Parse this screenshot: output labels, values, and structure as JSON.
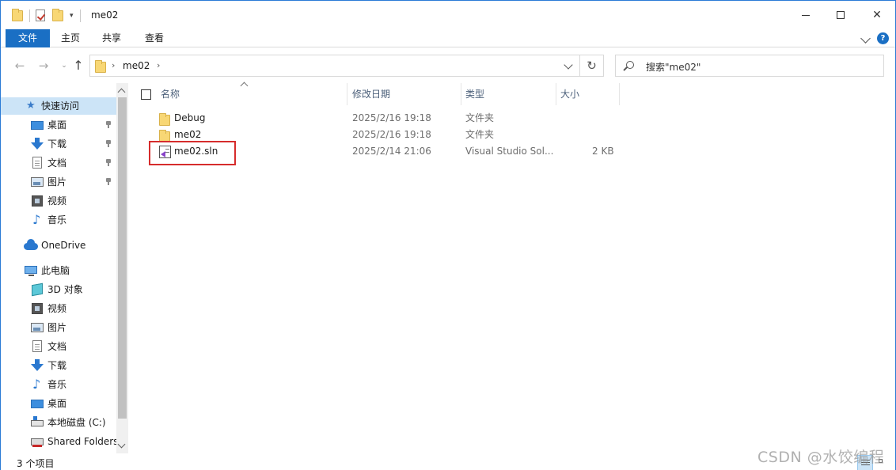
{
  "window": {
    "title": "me02",
    "minimize_icon": "minimize-icon",
    "maximize_icon": "maximize-icon",
    "close_label": "✕"
  },
  "ribbon": {
    "tabs": [
      {
        "label": "文件",
        "active": true
      },
      {
        "label": "主页",
        "active": false
      },
      {
        "label": "共享",
        "active": false
      },
      {
        "label": "查看",
        "active": false
      }
    ],
    "help_label": "?"
  },
  "navbar": {
    "back_glyph": "←",
    "forward_glyph": "→",
    "recent_glyph": "⌄",
    "up_glyph": "↑",
    "breadcrumb": [
      "me02"
    ],
    "refresh_glyph": "↻",
    "search_placeholder": "搜索\"me02\""
  },
  "sidebar": {
    "items": [
      {
        "label": "快速访问",
        "icon": "star-icon",
        "pinned": false,
        "selected": true
      },
      {
        "label": "桌面",
        "icon": "desktop-icon",
        "pinned": true
      },
      {
        "label": "下载",
        "icon": "download-icon",
        "pinned": true
      },
      {
        "label": "文档",
        "icon": "document-icon",
        "pinned": true
      },
      {
        "label": "图片",
        "icon": "pictures-icon",
        "pinned": true
      },
      {
        "label": "视频",
        "icon": "videos-icon",
        "pinned": false
      },
      {
        "label": "音乐",
        "icon": "music-icon",
        "pinned": false
      },
      {
        "label": "OneDrive",
        "icon": "onedrive-icon",
        "pinned": false
      },
      {
        "label": "此电脑",
        "icon": "this-pc-icon",
        "pinned": false
      },
      {
        "label": "3D 对象",
        "icon": "3d-objects-icon",
        "pinned": false
      },
      {
        "label": "视频",
        "icon": "videos-icon",
        "pinned": false
      },
      {
        "label": "图片",
        "icon": "pictures-icon",
        "pinned": false
      },
      {
        "label": "文档",
        "icon": "document-icon",
        "pinned": false
      },
      {
        "label": "下载",
        "icon": "download-icon",
        "pinned": false
      },
      {
        "label": "音乐",
        "icon": "music-icon",
        "pinned": false
      },
      {
        "label": "桌面",
        "icon": "desktop-icon",
        "pinned": false
      },
      {
        "label": "本地磁盘 (C:)",
        "icon": "local-disk-icon",
        "pinned": false
      },
      {
        "label": "Shared Folders",
        "icon": "shared-folders-icon",
        "pinned": false
      }
    ]
  },
  "filelist": {
    "columns": [
      "名称",
      "修改日期",
      "类型",
      "大小"
    ],
    "rows": [
      {
        "name": "Debug",
        "date": "2025/2/16 19:18",
        "type": "文件夹",
        "size": "",
        "icon": "folder-icon"
      },
      {
        "name": "me02",
        "date": "2025/2/16 19:18",
        "type": "文件夹",
        "size": "",
        "icon": "folder-icon"
      },
      {
        "name": "me02.sln",
        "date": "2025/2/14 21:06",
        "type": "Visual Studio Sol...",
        "size": "2 KB",
        "icon": "visual-studio-solution-icon"
      }
    ],
    "highlighted_row": "me02.sln",
    "highlight_color": "#d62c2c"
  },
  "status": {
    "item_count": "3 个项目"
  },
  "watermark": "CSDN @水饺编程",
  "colors": {
    "accent": "#1a6fc4",
    "selection": "#cce4f7",
    "folder": "#f8d775",
    "window_border": "#2b7bd6"
  }
}
